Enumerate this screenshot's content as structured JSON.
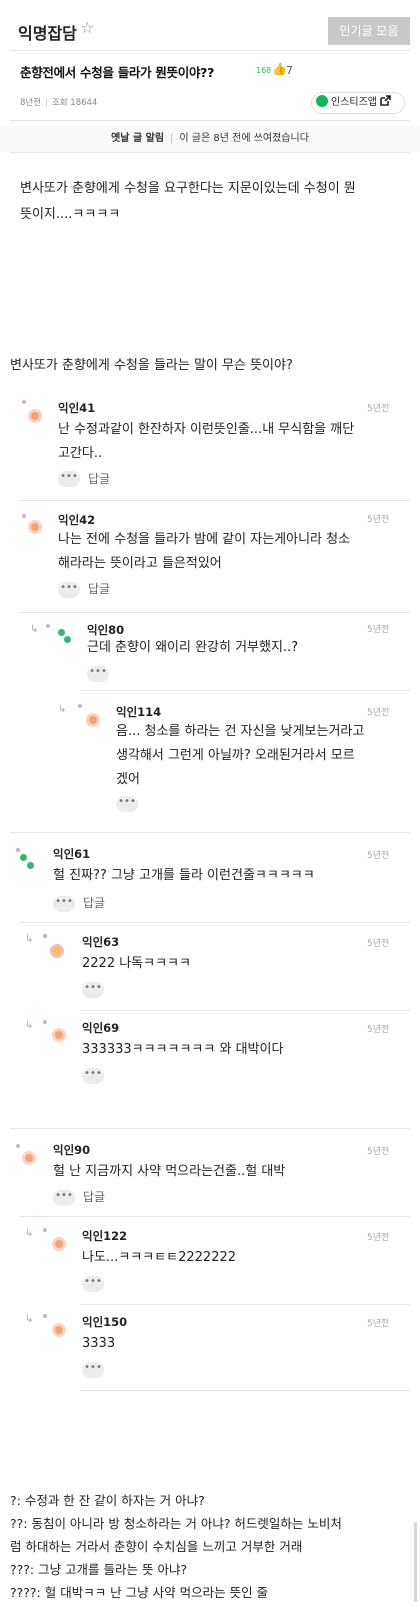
{
  "header": {
    "board_title": "익명잡담",
    "star_icon": "☆",
    "popular_button": "인기글 모음"
  },
  "post": {
    "title": "춘향전에서 수청을 들라가 뭔뜻이야??",
    "likes_small": "168",
    "thumb_icon": "👍",
    "thumb_count": "7",
    "age": "8년전",
    "views": "조회 18644",
    "app_button": "인스티즈앱",
    "notice_label": "옛날 글 알림",
    "notice_text": "이 글은 8년 전에 쓰여졌습니다",
    "body_line1": "변사또가 춘향에게 수청을 요구한다는 지문이있는데 수청이 뭔",
    "body_line2": "뜻이지....ㅋㅋㅋㅋ",
    "question": "변사또가 춘향에게 수청을 들라는 말이 무슨 뜻이야?"
  },
  "labels": {
    "reply": "답글",
    "more": "•••"
  },
  "comments": [
    {
      "nick": "익인41",
      "time": "5년전",
      "lines": [
        "난 수정과같이 한잔하자 이런뜻인줄...내 무식함을 깨단",
        "고간다.."
      ]
    },
    {
      "nick": "익인42",
      "time": "5년전",
      "lines": [
        "나는 전에 수청을 들라가 밤에 같이 자는게아니라 청소",
        "해라라는 뜻이라고 들은적있어"
      ]
    },
    {
      "nick": "익인80",
      "time": "5년전",
      "lines": [
        "근데 춘향이 왜이리 완강히 거부했지..?"
      ]
    },
    {
      "nick": "익인114",
      "time": "5년전",
      "lines": [
        "음... 청소를 하라는 건 자신을 낮게보는거라고",
        "생각해서 그런게 아닐까? 오래된거라서 모르",
        "겠어"
      ]
    },
    {
      "nick": "익인61",
      "time": "5년전",
      "lines": [
        "헐 진짜?? 그냥 고개를 들라 이런건줄ㅋㅋㅋㅋㅋ"
      ]
    },
    {
      "nick": "익인63",
      "time": "5년전",
      "lines": [
        "2222 나독ㅋㅋㅋㅋ"
      ]
    },
    {
      "nick": "익인69",
      "time": "5년전",
      "lines": [
        "333333ㅋㅋㅋㅋㅋㅋㅋ 와 대박이다"
      ]
    },
    {
      "nick": "익인90",
      "time": "5년전",
      "lines": [
        "헐 난 지금까지 사약 먹으라는건줄..헐 대박"
      ]
    },
    {
      "nick": "익인122",
      "time": "5년전",
      "lines": [
        "나도...ㅋㅋㅋㅌㅌ2222222"
      ]
    },
    {
      "nick": "익인150",
      "time": "5년전",
      "lines": [
        "3333"
      ]
    }
  ],
  "summary": [
    "?: 수정과 한 잔 같이 하자는 거 아냐?",
    "??: 동침이 아니라 방 청소하라는 거 아냐? 허드렛일하는 노비처",
    "럼 하대하는 거라서 춘향이 수치심을 느끼고 거부한 거래",
    "???: 그냥 고개를 들라는 뜻 아냐?",
    "????: 헐 대박ㅋㅋ 난 그냥 사약 먹으라는 뜻인 줄"
  ]
}
